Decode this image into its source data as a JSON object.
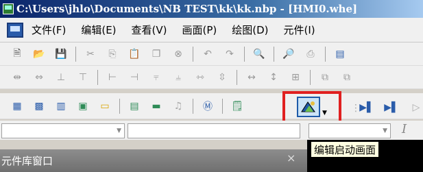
{
  "window": {
    "title": "C:\\Users\\jhlo\\Documents\\NB TEST\\kk\\kk.nbp - [HMI0.whe]"
  },
  "menubar": {
    "items": [
      "文件(F)",
      "编辑(E)",
      "查看(V)",
      "画面(P)",
      "绘图(D)",
      "元件(I)"
    ]
  },
  "toolbar3": {
    "highlighted_button": "edit-startup-screen"
  },
  "panel": {
    "title": "元件库窗口",
    "close": "×"
  },
  "tooltip": {
    "text": "编辑启动画面"
  },
  "colors": {
    "highlight": "#e02020",
    "active_button": "#cce4f7",
    "title_bar": "#0a246a"
  }
}
